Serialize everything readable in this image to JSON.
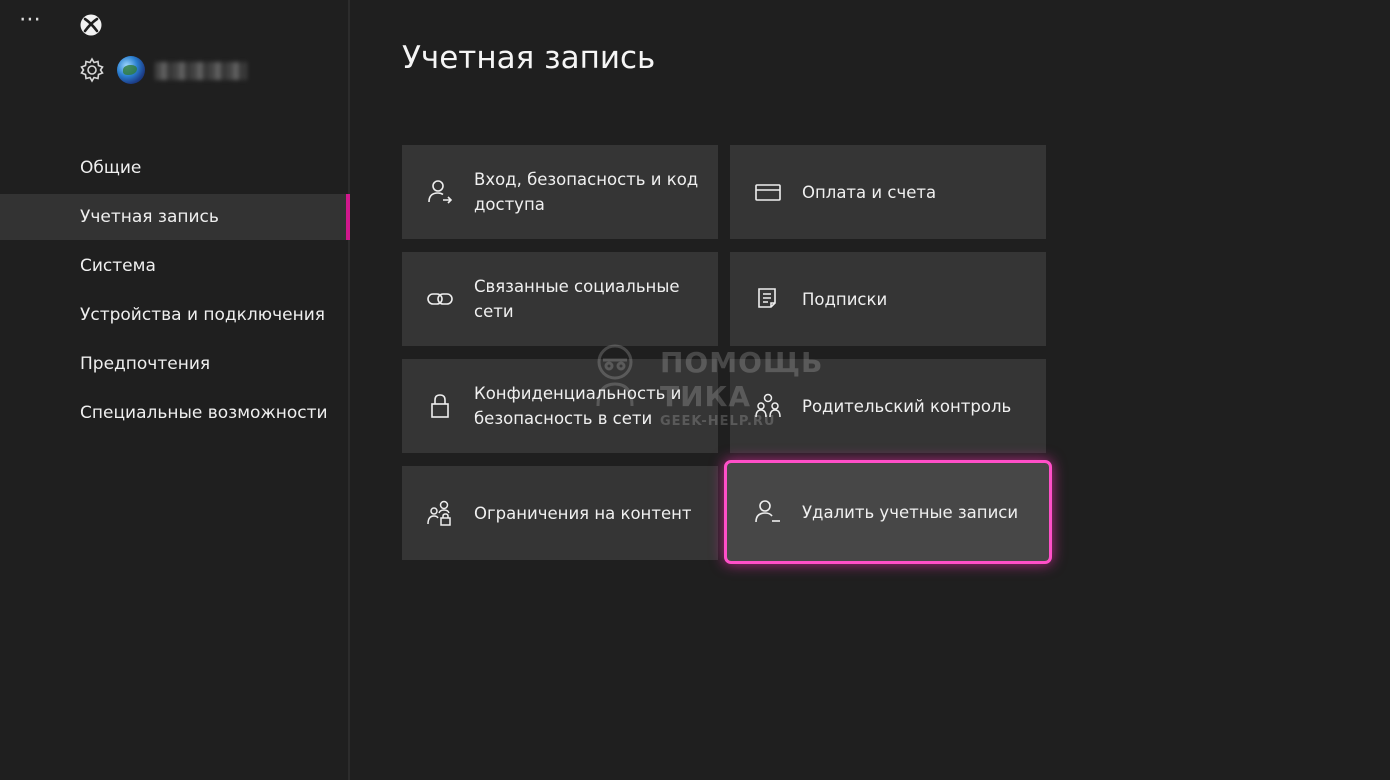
{
  "sidebar": {
    "more_label": "⋯",
    "gamertag": "",
    "items": [
      {
        "label": "Общие",
        "active": false
      },
      {
        "label": "Учетная запись",
        "active": true
      },
      {
        "label": "Система",
        "active": false
      },
      {
        "label": "Устройства и подключения",
        "active": false
      },
      {
        "label": "Предпочтения",
        "active": false
      },
      {
        "label": "Специальные возможности",
        "active": false
      }
    ]
  },
  "main": {
    "title": "Учетная запись",
    "tiles": [
      {
        "label": "Вход, безопасность и код доступа",
        "icon": "person-arrow-icon"
      },
      {
        "label": "Оплата и счета",
        "icon": "card-icon"
      },
      {
        "label": "Связанные социальные сети",
        "icon": "link-icon"
      },
      {
        "label": "Подписки",
        "icon": "subscriptions-icon"
      },
      {
        "label": "Конфиденциальность и безопасность в сети",
        "icon": "lock-icon"
      },
      {
        "label": "Родительский контроль",
        "icon": "family-icon"
      },
      {
        "label": "Ограничения на контент",
        "icon": "content-restrictions-icon"
      },
      {
        "label": "Удалить учетные записи",
        "icon": "remove-account-icon",
        "focused": true
      }
    ]
  },
  "watermark": {
    "line1": "ПОМОЩЬ",
    "line2": "ТИКА",
    "line3": "GEEK-HELP.RU"
  },
  "colors": {
    "background": "#1f1f1f",
    "tile": "#353535",
    "active_indicator": "#d1178c",
    "focus_outline": "#ff4fc8"
  }
}
